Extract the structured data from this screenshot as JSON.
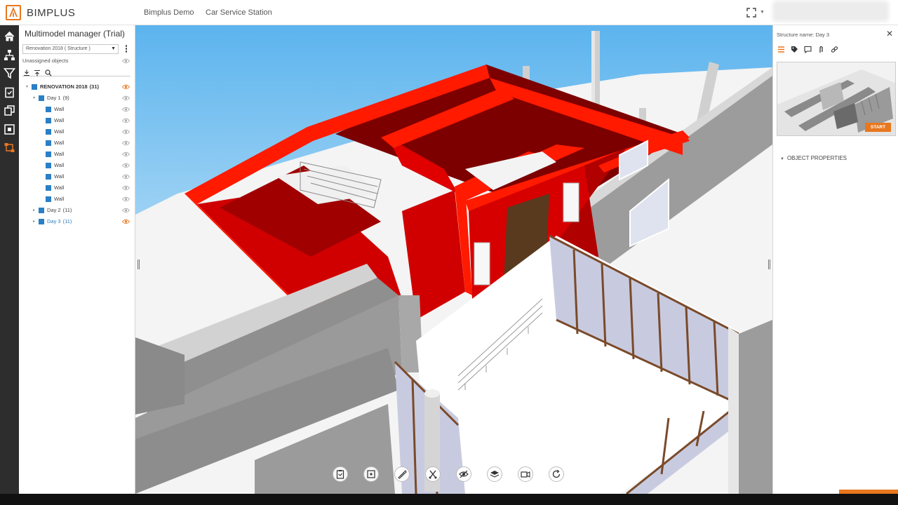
{
  "app": {
    "name": "BIMPLUS"
  },
  "topbar": {
    "links": [
      "Bimplus Demo",
      "Car Service Station"
    ],
    "expand_icon": "expand-icon"
  },
  "rail": {
    "items": [
      "home-icon",
      "hierarchy-icon",
      "filter-icon",
      "clipboard-icon",
      "models-icon",
      "compare-icon",
      "multimodel-icon"
    ],
    "accent": "#e8771e"
  },
  "left_panel": {
    "title": "Multimodel manager (Trial)",
    "selected_model": "Renovation 2018 ( Structure )",
    "unassigned_label": "Unassigned objects",
    "tree": [
      {
        "label": "RENOVATION 2018",
        "count": "(31)",
        "level": 0,
        "expanded": true,
        "style": "bold",
        "eye": "orange"
      },
      {
        "label": "Day 1",
        "count": "(9)",
        "level": 1,
        "expanded": true,
        "style": "normal",
        "eye": "gray"
      },
      {
        "label": "Wall",
        "count": "",
        "level": 2,
        "style": "normal",
        "eye": "gray"
      },
      {
        "label": "Wall",
        "count": "",
        "level": 2,
        "style": "normal",
        "eye": "gray"
      },
      {
        "label": "Wall",
        "count": "",
        "level": 2,
        "style": "normal",
        "eye": "gray"
      },
      {
        "label": "Wall",
        "count": "",
        "level": 2,
        "style": "normal",
        "eye": "gray"
      },
      {
        "label": "Wall",
        "count": "",
        "level": 2,
        "style": "normal",
        "eye": "gray"
      },
      {
        "label": "Wall",
        "count": "",
        "level": 2,
        "style": "normal",
        "eye": "gray"
      },
      {
        "label": "Wall",
        "count": "",
        "level": 2,
        "style": "normal",
        "eye": "gray"
      },
      {
        "label": "Wall",
        "count": "",
        "level": 2,
        "style": "normal",
        "eye": "gray"
      },
      {
        "label": "Wall",
        "count": "",
        "level": 2,
        "style": "normal",
        "eye": "gray"
      },
      {
        "label": "Day 2",
        "count": "(11)",
        "level": 1,
        "expanded": false,
        "style": "normal",
        "eye": "gray"
      },
      {
        "label": "Day 3",
        "count": "(11)",
        "level": 1,
        "expanded": false,
        "style": "blue",
        "eye": "orange"
      }
    ]
  },
  "viewport": {
    "toolbar": [
      "clipboard-icon",
      "select-area-icon",
      "measure-icon",
      "section-icon",
      "hide-icon",
      "layers-icon",
      "camera-icon",
      "refresh-icon"
    ]
  },
  "right_panel": {
    "title": "Structure name: Day 3",
    "icons": [
      "list-icon",
      "tag-icon",
      "comment-icon",
      "attachment-icon",
      "link-icon"
    ],
    "start_label": "START",
    "section_label": "OBJECT PROPERTIES"
  }
}
